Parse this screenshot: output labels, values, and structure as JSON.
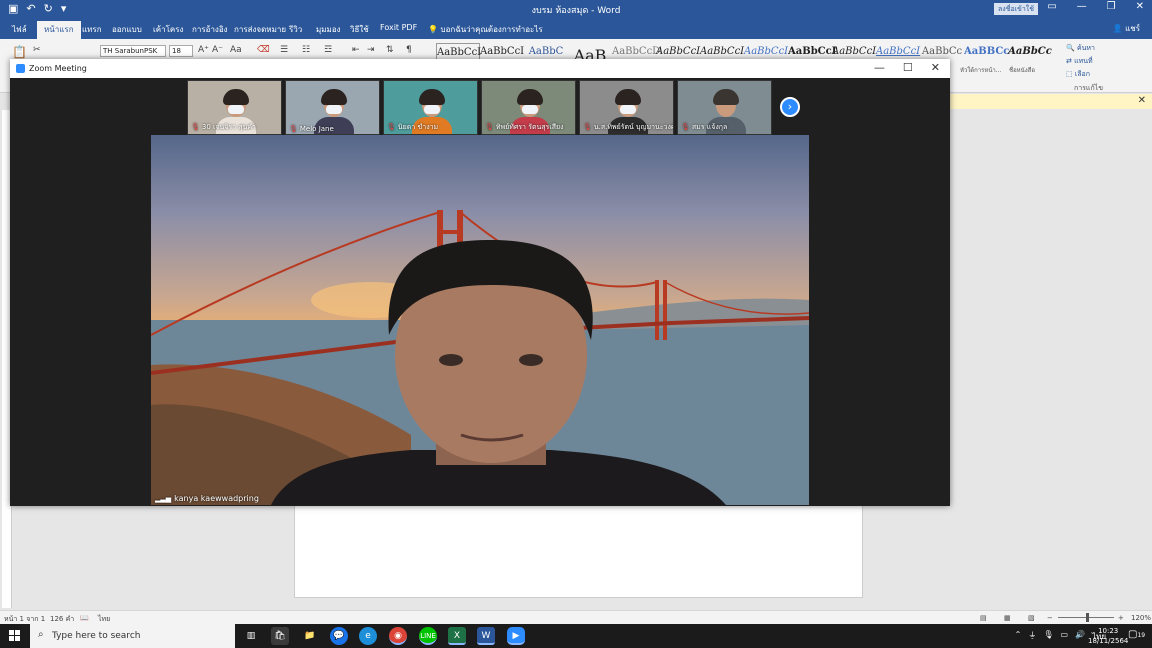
{
  "word": {
    "title": "งบรม ห้องสมุด - Word",
    "sign_in": "ลงชื่อเข้าใช้",
    "share": "แชร์",
    "tabs": [
      "ไฟล์",
      "หน้าแรก",
      "แทรก",
      "ออกแบบ",
      "เค้าโครง",
      "การอ้างอิง",
      "การส่งจดหมาย",
      "รีวิว",
      "มุมมอง",
      "วิธีใช้",
      "Foxit PDF"
    ],
    "tell_me": "บอกฉันว่าคุณต้องการทำอะไร",
    "font_name": "TH SarabunPSK",
    "font_size": "18",
    "styles": [
      "AaBbCcI",
      "AaBbCcI",
      "AaBbC",
      "AaB",
      "AaBbCcD",
      "AaBbCcI",
      "AaBbCcI",
      "AaBbCcI",
      "AaBbCcI",
      "AaBbCcI",
      "AaBbCcI",
      "AaBbCc",
      "AaBBCc",
      "AaBbCc"
    ],
    "style_subs": [
      "หัวใต้การหน้า...",
      "ชื่อหนังสือ"
    ],
    "find_label": "ค้นหา",
    "replace_label": "แทนที่",
    "select_label": "เลือก",
    "editing_label": "การแก้ไข",
    "status": {
      "page": "หน้า 1 จาก 1",
      "words": "126 คำ",
      "lang": "ไทย",
      "zoom": "120%"
    }
  },
  "zoom": {
    "title": "Zoom Meeting",
    "participants": [
      {
        "name": "30 เจนจิรา สุนคำ",
        "bg": "#b8b0a4",
        "shirt": "#e9e2da",
        "hair": "#2a2320",
        "mask": true
      },
      {
        "name": "Melo Jane",
        "bg": "#9aa7b1",
        "shirt": "#3e3f57",
        "hair": "#2a2320",
        "mask": true
      },
      {
        "name": "นิยดา ขำงาม",
        "bg": "#4f9c9c",
        "shirt": "#e07b24",
        "hair": "#2a2320",
        "mask": true
      },
      {
        "name": "ทิพย์ทัศรา รัตนสุรเสียง",
        "bg": "#7d8a7a",
        "shirt": "#c43c4a",
        "hair": "#2a2320",
        "mask": true
      },
      {
        "name": "น.ส.ทิพย์รัตน์ บุญมานะวงศ์",
        "bg": "#8c8c8c",
        "shirt": "#2c2c2c",
        "hair": "#2a2320",
        "mask": true
      },
      {
        "name": "สมร แจ้งกุล",
        "bg": "#7f8c91",
        "shirt": "#55606a",
        "hair": "#3a3530",
        "mask": false
      }
    ],
    "active_speaker": "kanya kaewwadpring"
  },
  "taskbar": {
    "search_placeholder": "Type here to search",
    "time": "10:23",
    "date": "18/11/2564",
    "lang": "ไทย",
    "notification_count": "19"
  }
}
